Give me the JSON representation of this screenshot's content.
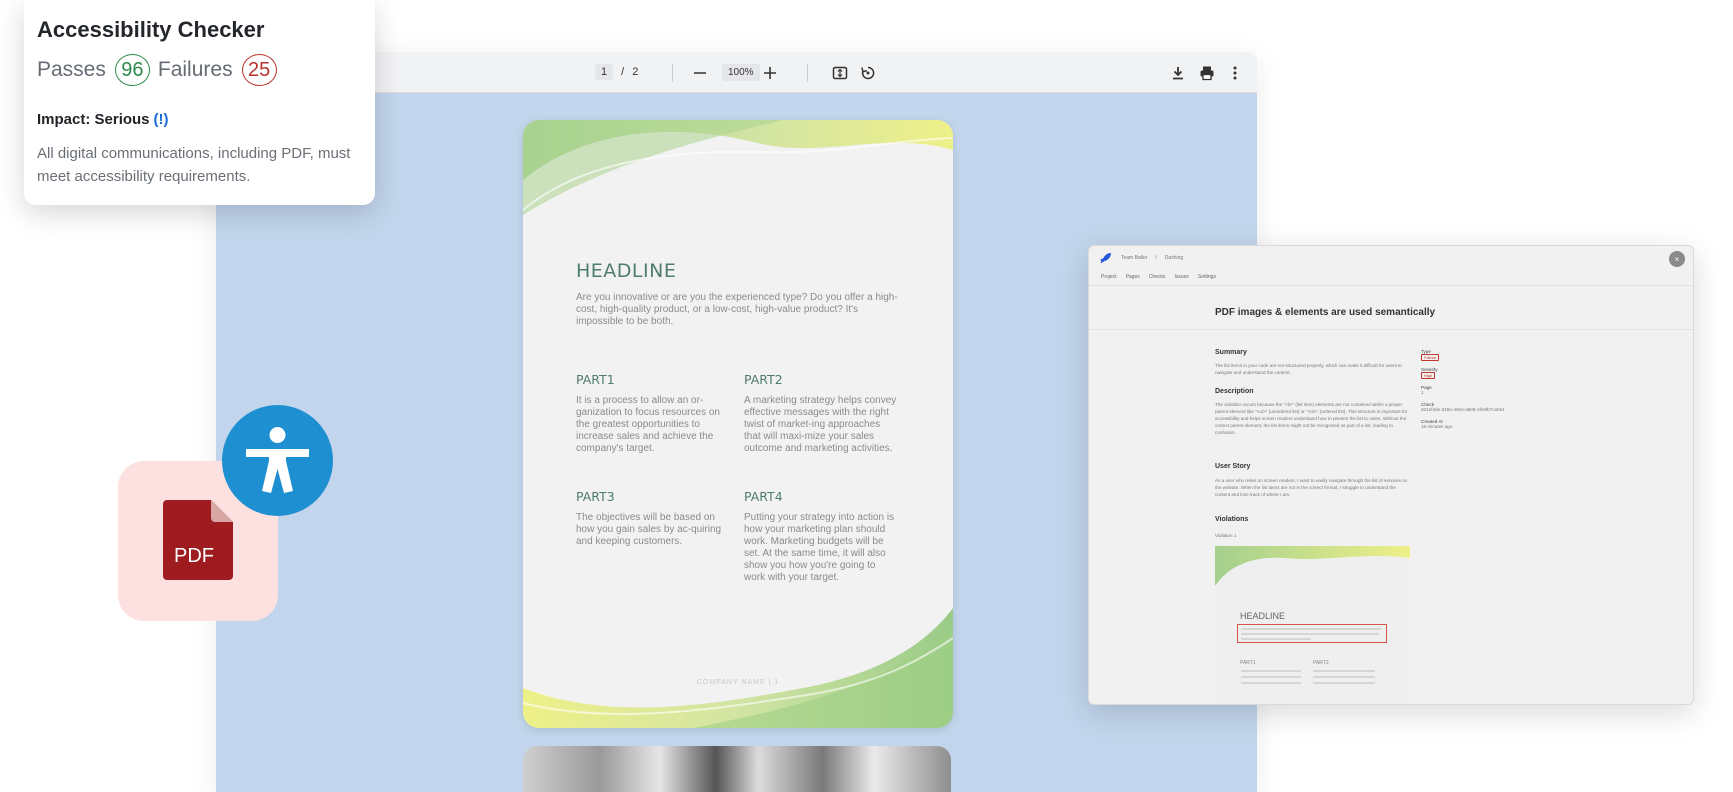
{
  "viewer": {
    "current_page": "1",
    "page_separator": "/",
    "total_pages": "2",
    "zoom": "100%"
  },
  "page1": {
    "headline": "HEADLINE",
    "intro": "Are you innovative or are you the experienced type? Do you offer a high-cost, high-quality product, or a low-cost, high-value product? It's impossible to be both.",
    "parts": [
      {
        "title": "PART1",
        "body": "It is a process to allow an or-ganization to focus resources on the greatest opportunities to increase sales and achieve the company's target."
      },
      {
        "title": "PART2",
        "body": "A marketing strategy helps convey effective messages with the right twist of market-ing approaches that will maxi-mize your sales outcome and marketing activities."
      },
      {
        "title": "PART3",
        "body": "The objectives will be based on how you gain sales by ac-quiring and keeping customers."
      },
      {
        "title": "PART4",
        "body": "Putting your strategy into action is how your marketing plan should work. Marketing budgets will be set. At the same time, it will also show you how you're going to work with your target."
      }
    ],
    "footer": "COMPANY NAME  |  1"
  },
  "checker": {
    "title": "Accessibility Checker",
    "passes_label": "Passes",
    "passes_count": "96",
    "failures_label": "Failures",
    "failures_count": "25",
    "impact_label": "Impact: Serious",
    "impact_marker": "(!)",
    "description": "All digital communications, including PDF, must meet accessibility requirements."
  },
  "pdf_badge": {
    "label": "PDF",
    "tile_color": "#fde0e0",
    "doc_color": "#9e1c1f",
    "a11y_color": "#1e90d1"
  },
  "detail": {
    "breadcrumb": [
      "Team Baller",
      "/",
      "Dashing"
    ],
    "nav": [
      "Project",
      "Pages",
      "Checks",
      "Issues",
      "Settings"
    ],
    "close": "×",
    "title": "PDF images & elements are used semantically",
    "summary_h": "Summary",
    "summary": "The list items in your code are not structured properly, which can make it difficult for users to navigate and understand the content.",
    "description_h": "Description",
    "description": "The violation occurs because the \"<li>\" (list item) elements are not contained within a proper parent element like \"<ul>\" (unordered list) or \"<ol>\" (ordered list). This structure is important for accessibility and helps screen readers understand how to present the list to users. Without the correct parent element, the list items might not be recognized as part of a list, leading to confusion.",
    "story_h": "User Story",
    "story": "As a user who relies on screen readers, I want to easily navigate through the list of services on the website. When the list items are not in the correct format, I struggle to understand the content and lose track of where I am.",
    "violations_h": "Violations",
    "violation_item": "Violation 1",
    "meta": {
      "type_label": "Type",
      "type_value": "Failure",
      "severity_label": "Severity",
      "severity_value": "High",
      "page_label": "Page",
      "page_value": "1",
      "check_label": "Check",
      "check_value": "321ef4de-d15e-40ee-a508-1fe0fb7ca0e1",
      "created_label": "Created At",
      "created_value": "15 minutes ago"
    },
    "thumb": {
      "headline": "HEADLINE",
      "part1": "PART1",
      "part2": "PART2"
    }
  }
}
